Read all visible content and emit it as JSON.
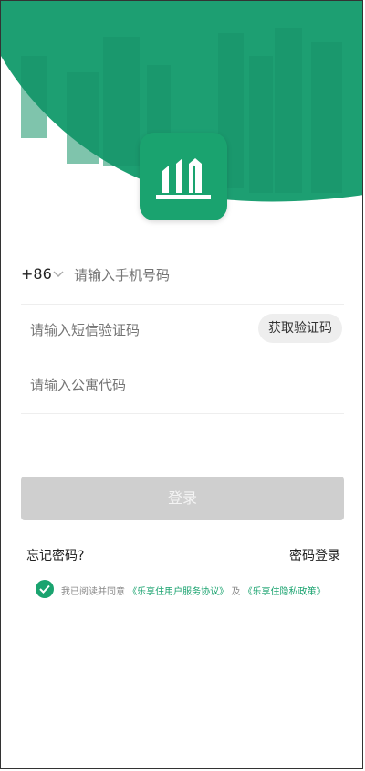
{
  "colors": {
    "brand_green": "#1aa36f",
    "header_green": "#1d9f72",
    "disabled_button": "#cfcfcf",
    "placeholder": "#aaaaaa"
  },
  "app": {
    "logo_icon": "building-icon"
  },
  "form": {
    "country_code": "+86",
    "phone_placeholder": "请输入手机号码",
    "code_placeholder": "请输入短信验证码",
    "get_code_label": "获取验证码",
    "apartment_placeholder": "请输入公寓代码"
  },
  "login": {
    "button_label": "登录",
    "forgot_password": "忘记密码?",
    "password_login": "密码登录"
  },
  "agreement": {
    "checked": true,
    "prefix": "我已阅读并同意",
    "service_agreement": "《乐享住用户服务协议》",
    "connector": "及",
    "privacy_policy": "《乐享住隐私政策》"
  }
}
